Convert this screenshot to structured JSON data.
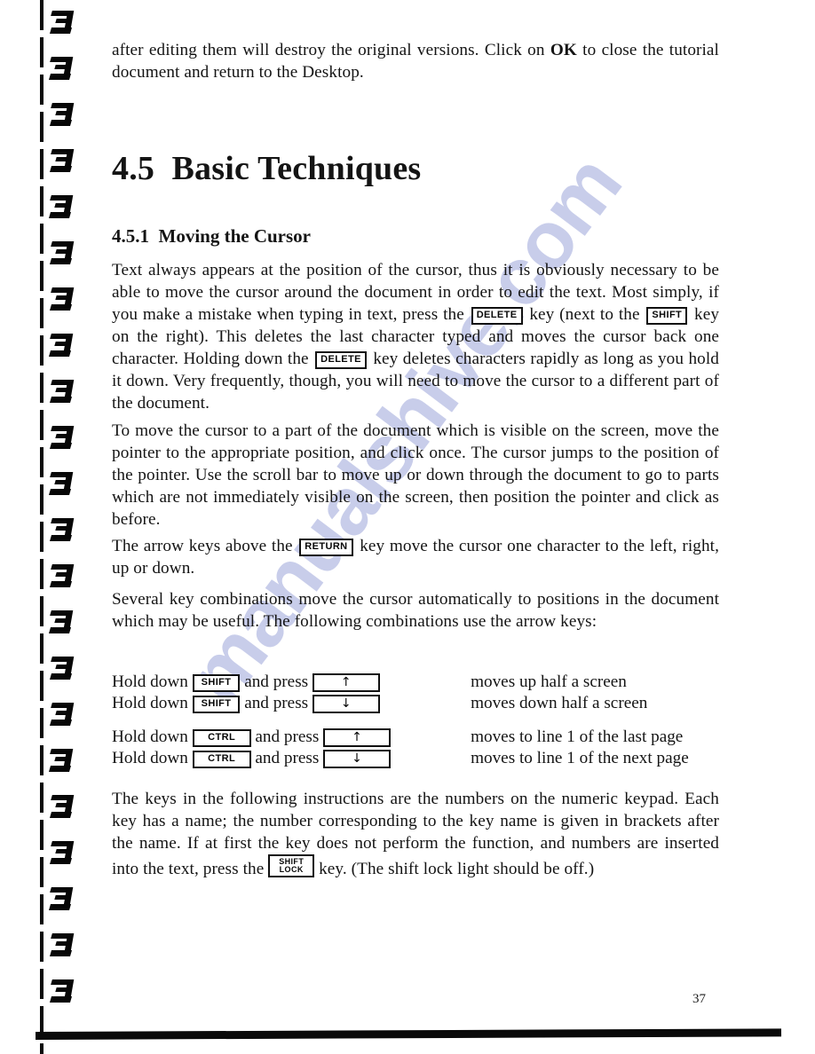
{
  "document": {
    "page_number": "37",
    "watermark_text": "manualshive.com",
    "watermark_color": "#c8cdea"
  },
  "intro": {
    "text_before_ok": "after editing them will destroy the original versions. Click on ",
    "ok_label": "OK",
    "text_after_ok": " to close the tutorial document and return to the Desktop."
  },
  "headings": {
    "chapter_number": "4.5",
    "chapter_title": "Basic Techniques",
    "section_number": "4.5.1",
    "section_title": "Moving the Cursor"
  },
  "paragraphs": {
    "p1": {
      "seg1": "Text always appears at the position of the cursor, thus it is obviously necessary to be able to move the cursor around the document in order to edit the text. Most simply, if you make a mistake when typing in text, press the ",
      "key1": "DELETE",
      "seg2": " key (next to the ",
      "key2": "SHIFT",
      "seg3": " key on the right). This deletes the last character typed and moves the cursor back one character. Holding down the ",
      "key3": "DELETE",
      "seg4": " key deletes characters rapidly as long as you hold it down. Very frequently, though, you will need to move the cursor to a different part of the document."
    },
    "p2": {
      "text": "To move the cursor to a part of the document which is visible on the screen, move the pointer to the appropriate position, and click once. The cursor jumps to the position of the pointer. Use the scroll bar to move up or down through the document to go to parts which are not immediately visible on the screen, then position the pointer and click as before."
    },
    "p3": {
      "seg1": "The arrow keys above the ",
      "key1": "RETURN",
      "seg2": " key move the cursor one character to the left, right, up or down."
    },
    "p4": {
      "text": "Several key combinations move the cursor automatically to positions in the document which may be useful. The following combinations use the arrow keys:"
    },
    "p5": {
      "seg1": "The keys in the following instructions are the numbers on the numeric keypad. Each key has a name; the number corresponding to the key name is given in brackets after the name. If at first the key does not perform the function, and numbers are inserted into the text, press the ",
      "key1_line1": "SHIFT",
      "key1_line2": "LOCK",
      "seg2": " key. (The shift lock light should be off.)"
    }
  },
  "key_table": {
    "prefix": "Hold down",
    "connector": "and press",
    "rows": [
      {
        "modifier": "SHIFT",
        "arrow": "↑",
        "description": "moves up half a screen"
      },
      {
        "modifier": "SHIFT",
        "arrow": "↓",
        "description": "moves down half a screen"
      },
      {
        "modifier": "CTRL",
        "arrow": "↑",
        "description": "moves to line 1 of the last page"
      },
      {
        "modifier": "CTRL",
        "arrow": "↓",
        "description": "moves to line 1 of the next page"
      }
    ]
  }
}
